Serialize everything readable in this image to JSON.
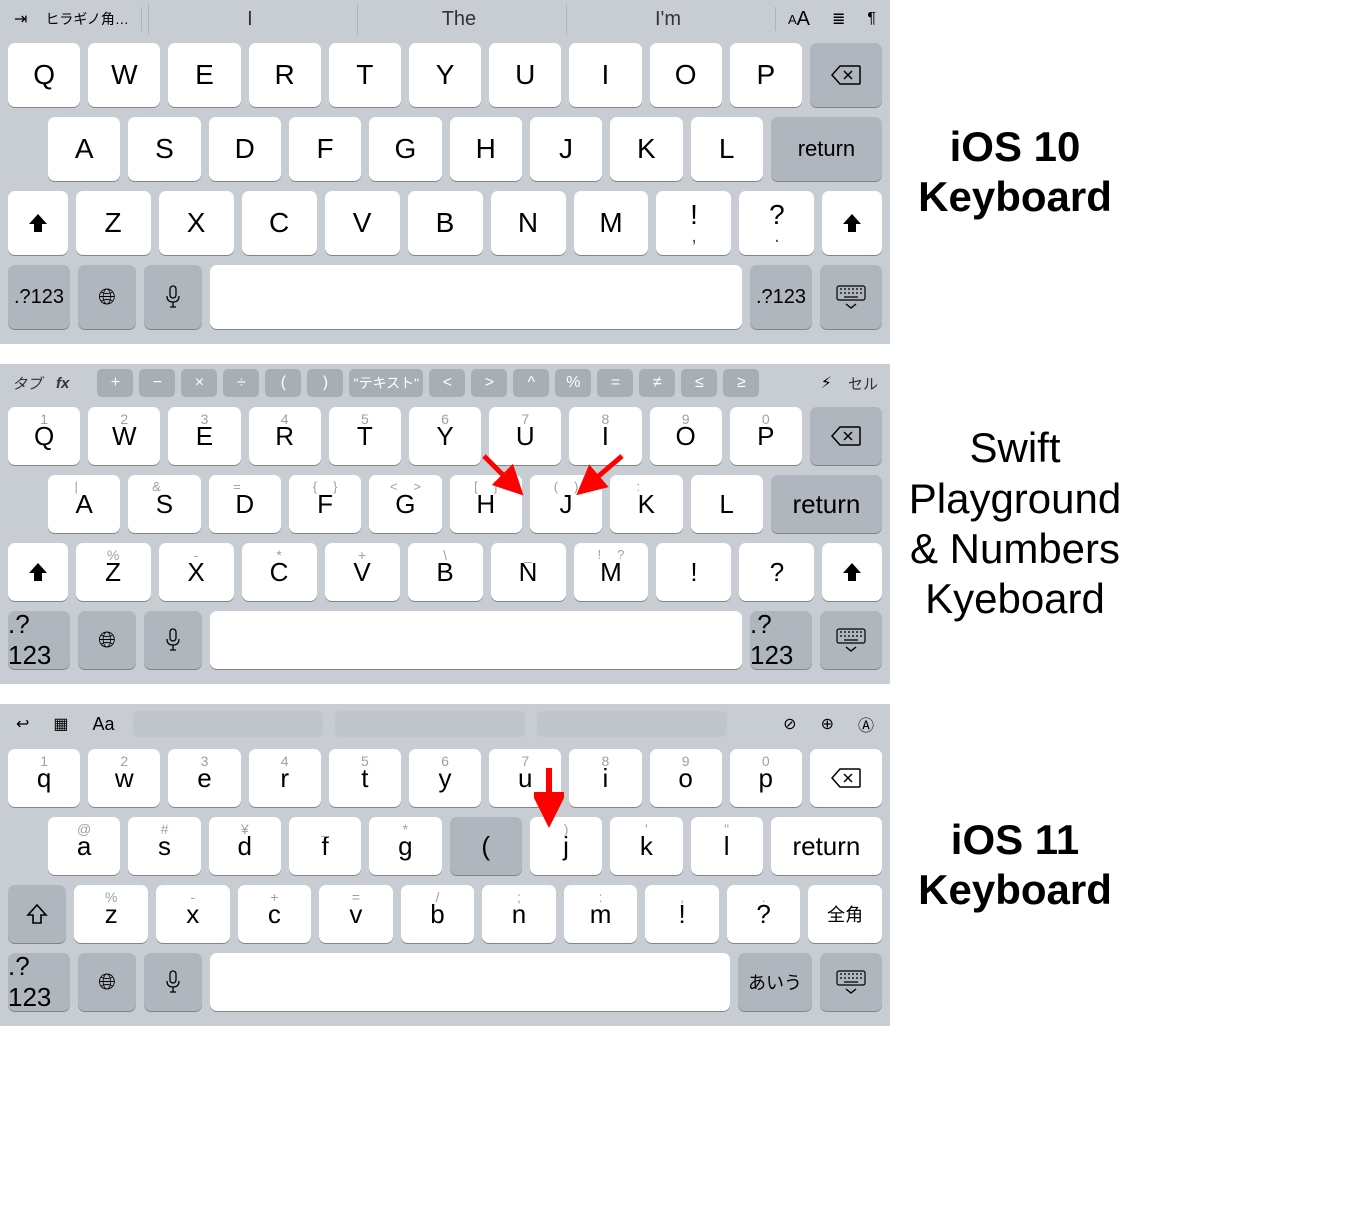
{
  "labels": {
    "ios10": "iOS 10 Keyboard",
    "swift": "Swift Playground & Numbers Kyeboard",
    "ios11": "iOS 11 Keyboard"
  },
  "kb1": {
    "topbar": {
      "font_hint": "ヒラギノ角…",
      "sugg": [
        "I",
        "The",
        "I'm"
      ],
      "aA": "A",
      "aA2": "A"
    },
    "row1": [
      "Q",
      "W",
      "E",
      "R",
      "T",
      "Y",
      "U",
      "I",
      "O",
      "P"
    ],
    "row2": [
      "A",
      "S",
      "D",
      "F",
      "G",
      "H",
      "J",
      "K",
      "L"
    ],
    "row3": [
      "Z",
      "X",
      "C",
      "V",
      "B",
      "N",
      "M"
    ],
    "punct": [
      "!",
      "?"
    ],
    "sub_punct": [
      ",",
      "."
    ],
    "return": "return",
    "num": ".?123"
  },
  "kb2": {
    "tab": "タブ",
    "fx": "fx",
    "symbols": [
      "+",
      "−",
      "×",
      "÷",
      "(",
      ")",
      "\"テキスト\"",
      "<",
      ">",
      "^",
      "%",
      "=",
      "≠",
      "≤",
      "≥"
    ],
    "cell": "セル",
    "row1": [
      {
        "m": "Q",
        "s": "1"
      },
      {
        "m": "W",
        "s": "2"
      },
      {
        "m": "E",
        "s": "3"
      },
      {
        "m": "R",
        "s": "4"
      },
      {
        "m": "T",
        "s": "5"
      },
      {
        "m": "Y",
        "s": "6"
      },
      {
        "m": "U",
        "s": "7"
      },
      {
        "m": "I",
        "s": "8"
      },
      {
        "m": "O",
        "s": "9"
      },
      {
        "m": "P",
        "s": "0"
      }
    ],
    "row2": [
      {
        "m": "A",
        "l": "|",
        "r": ""
      },
      {
        "m": "S",
        "l": "&",
        "r": ""
      },
      {
        "m": "D",
        "l": "=",
        "r": ""
      },
      {
        "m": "F",
        "l": "{",
        "r": "}"
      },
      {
        "m": "G",
        "l": "<",
        "r": ">"
      },
      {
        "m": "H",
        "l": "[",
        "r": "]"
      },
      {
        "m": "J",
        "l": "(",
        "r": ")"
      },
      {
        "m": "K",
        "l": ":",
        "r": ""
      },
      {
        "m": "L",
        "l": "",
        "r": ""
      }
    ],
    "row3": [
      {
        "m": "Z",
        "s": "%"
      },
      {
        "m": "X",
        "s": "-"
      },
      {
        "m": "C",
        "s": "*"
      },
      {
        "m": "V",
        "s": "+"
      },
      {
        "m": "B",
        "s": "\\"
      },
      {
        "m": "N",
        "s": "_"
      },
      {
        "m": "M",
        "l": "!",
        "r": "?"
      }
    ],
    "punct": [
      "!",
      "?"
    ],
    "return": "return",
    "num": ".?123"
  },
  "kb3": {
    "aA": "Aa",
    "row1": [
      {
        "m": "q",
        "s": "1"
      },
      {
        "m": "w",
        "s": "2"
      },
      {
        "m": "e",
        "s": "3"
      },
      {
        "m": "r",
        "s": "4"
      },
      {
        "m": "t",
        "s": "5"
      },
      {
        "m": "y",
        "s": "6"
      },
      {
        "m": "u",
        "s": "7"
      },
      {
        "m": "i",
        "s": "8"
      },
      {
        "m": "o",
        "s": "9"
      },
      {
        "m": "p",
        "s": "0"
      }
    ],
    "row2": [
      {
        "m": "a",
        "s": "@"
      },
      {
        "m": "s",
        "s": "#"
      },
      {
        "m": "d",
        "s": "¥"
      },
      {
        "m": "f",
        "s": "_"
      },
      {
        "m": "g",
        "s": "*"
      },
      {
        "m": "(",
        "s": "",
        "gray": true
      },
      {
        "m": "j",
        "s": ")"
      },
      {
        "m": "k",
        "s": "'"
      },
      {
        "m": "l",
        "s": "\""
      }
    ],
    "row3": [
      {
        "m": "z",
        "s": "%"
      },
      {
        "m": "x",
        "s": "-"
      },
      {
        "m": "c",
        "s": "+"
      },
      {
        "m": "v",
        "s": "="
      },
      {
        "m": "b",
        "s": "/"
      },
      {
        "m": "n",
        "s": ";"
      },
      {
        "m": "m",
        "s": ":"
      }
    ],
    "punct": [
      {
        "m": "!",
        "s": ","
      },
      {
        "m": "?",
        "s": "."
      }
    ],
    "return": "return",
    "zenkaku": "全角",
    "aiu": "あいう",
    "num": ".?123"
  }
}
